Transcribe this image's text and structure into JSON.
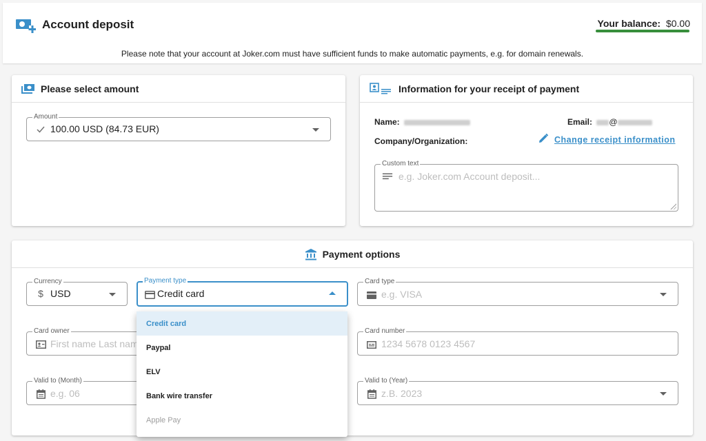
{
  "header": {
    "title": "Account deposit",
    "balance_label": "Your balance:",
    "balance_value": "$0.00",
    "notice": "Please note that your account at Joker.com must have sufficient funds to make automatic payments, e.g. for domain renewals."
  },
  "amount_card": {
    "title": "Please select amount",
    "amount_field": {
      "label": "Amount",
      "value": "100.00 USD (84.73 EUR)"
    }
  },
  "receipt_card": {
    "title": "Information for your receipt of payment",
    "name_label": "Name:",
    "email_label": "Email:",
    "email_at": "@",
    "company_label": "Company/Organization:",
    "change_link": "Change receipt information",
    "custom_text": {
      "label": "Custom text",
      "placeholder": "e.g. Joker.com Account deposit..."
    }
  },
  "payment_card": {
    "title": "Payment options",
    "currency": {
      "label": "Currency",
      "value": "USD"
    },
    "payment_type": {
      "label": "Payment type",
      "value": "Credit card"
    },
    "card_type": {
      "label": "Card type",
      "placeholder": "e.g. VISA"
    },
    "card_owner": {
      "label": "Card owner",
      "placeholder": "First name Last name"
    },
    "card_number": {
      "label": "Card number",
      "placeholder": "1234 5678 0123 4567"
    },
    "valid_month": {
      "label": "Valid to (Month)",
      "placeholder": "e.g. 06"
    },
    "valid_year": {
      "label": "Valid to (Year)",
      "placeholder": "z.B. 2023"
    }
  },
  "payment_type_dropdown": {
    "options": [
      {
        "label": "Credit card",
        "state": "selected"
      },
      {
        "label": "Paypal",
        "state": "normal"
      },
      {
        "label": "ELV",
        "state": "normal"
      },
      {
        "label": "Bank wire transfer",
        "state": "normal"
      },
      {
        "label": "Apple Pay",
        "state": "disabled"
      }
    ]
  },
  "colors": {
    "accent": "#3a8fc9",
    "balance_bar": "#388e3c",
    "selected_bg": "#e3eff8"
  }
}
